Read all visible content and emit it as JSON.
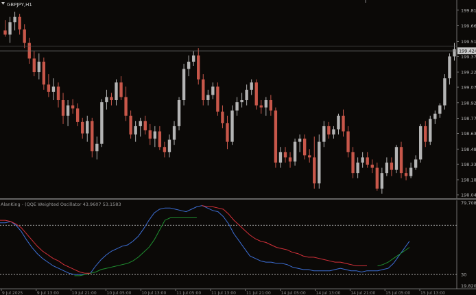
{
  "window": {
    "symbol": "GBPJPY,H1"
  },
  "colors": {
    "bull": "#b4b4b4",
    "bear": "#c8574a",
    "fast_line": "#3d6fd6",
    "slow_line": "#1f8f30",
    "up_line": "#d6303a",
    "bg": "#0b0907",
    "grid": "#8a8a8a"
  },
  "chart_data": [
    {
      "type": "candlestick",
      "symbol": "GBPJPY,H1",
      "ylim": [
        198.04,
        199.86
      ],
      "price_ticks": [
        "199.815",
        "199.665",
        "199.515",
        "199.370",
        "199.220",
        "199.075",
        "198.925",
        "198.775",
        "198.630",
        "198.480",
        "198.335",
        "198.185",
        "198.040"
      ],
      "current_price": "199.424",
      "ohlc": [
        [
          199.62,
          199.72,
          199.56,
          199.58
        ],
        [
          199.58,
          199.75,
          199.5,
          199.7
        ],
        [
          199.7,
          199.8,
          199.62,
          199.75
        ],
        [
          199.75,
          199.78,
          199.58,
          199.63
        ],
        [
          199.63,
          199.68,
          199.45,
          199.5
        ],
        [
          199.5,
          199.55,
          199.3,
          199.35
        ],
        [
          199.35,
          199.42,
          199.18,
          199.22
        ],
        [
          199.22,
          199.4,
          199.15,
          199.32
        ],
        [
          199.32,
          199.36,
          199.05,
          199.1
        ],
        [
          199.1,
          199.2,
          198.98,
          199.03
        ],
        [
          199.03,
          199.16,
          198.95,
          199.08
        ],
        [
          199.08,
          199.12,
          198.88,
          198.95
        ],
        [
          198.95,
          199.02,
          198.72,
          198.8
        ],
        [
          198.8,
          198.95,
          198.7,
          198.9
        ],
        [
          198.9,
          198.96,
          198.82,
          198.87
        ],
        [
          198.87,
          198.92,
          198.7,
          198.74
        ],
        [
          198.74,
          198.78,
          198.58,
          198.63
        ],
        [
          198.63,
          198.8,
          198.55,
          198.75
        ],
        [
          198.75,
          198.78,
          198.4,
          198.46
        ],
        [
          198.46,
          198.6,
          198.38,
          198.53
        ],
        [
          198.53,
          198.96,
          198.5,
          198.93
        ],
        [
          198.93,
          199.05,
          198.86,
          198.98
        ],
        [
          198.98,
          199.02,
          198.9,
          198.95
        ],
        [
          198.95,
          199.15,
          198.9,
          199.12
        ],
        [
          199.12,
          199.18,
          198.95,
          198.98
        ],
        [
          198.98,
          199.08,
          198.75,
          198.8
        ],
        [
          198.8,
          198.85,
          198.58,
          198.62
        ],
        [
          198.62,
          198.75,
          198.55,
          198.7
        ],
        [
          198.7,
          198.78,
          198.6,
          198.75
        ],
        [
          198.75,
          198.8,
          198.62,
          198.66
        ],
        [
          198.66,
          198.72,
          198.52,
          198.58
        ],
        [
          198.58,
          198.7,
          198.5,
          198.65
        ],
        [
          198.65,
          198.7,
          198.47,
          198.5
        ],
        [
          198.5,
          198.55,
          198.4,
          198.45
        ],
        [
          198.45,
          198.62,
          198.4,
          198.57
        ],
        [
          198.57,
          198.75,
          198.52,
          198.7
        ],
        [
          198.7,
          198.98,
          198.66,
          198.95
        ],
        [
          198.95,
          199.3,
          198.9,
          199.25
        ],
        [
          199.25,
          199.38,
          199.18,
          199.32
        ],
        [
          199.32,
          199.42,
          199.28,
          199.38
        ],
        [
          199.38,
          199.45,
          199.1,
          199.15
        ],
        [
          199.15,
          199.2,
          198.9,
          198.95
        ],
        [
          198.95,
          199.05,
          198.9,
          199.0
        ],
        [
          199.0,
          199.12,
          198.96,
          199.08
        ],
        [
          199.08,
          199.12,
          198.8,
          198.84
        ],
        [
          198.84,
          198.9,
          198.68,
          198.73
        ],
        [
          198.73,
          198.8,
          198.48,
          198.55
        ],
        [
          198.55,
          198.9,
          198.52,
          198.85
        ],
        [
          198.85,
          198.98,
          198.8,
          198.93
        ],
        [
          198.93,
          199.02,
          198.88,
          198.95
        ],
        [
          198.95,
          199.1,
          198.9,
          199.05
        ],
        [
          199.05,
          199.15,
          199.0,
          199.12
        ],
        [
          199.12,
          199.15,
          198.86,
          198.9
        ],
        [
          198.9,
          198.95,
          198.82,
          198.88
        ],
        [
          198.88,
          198.98,
          198.8,
          198.95
        ],
        [
          198.95,
          199.0,
          198.8,
          198.85
        ],
        [
          198.85,
          198.88,
          198.3,
          198.35
        ],
        [
          198.35,
          198.5,
          198.3,
          198.45
        ],
        [
          198.45,
          198.5,
          198.35,
          198.4
        ],
        [
          198.4,
          198.45,
          198.3,
          198.36
        ],
        [
          198.36,
          198.58,
          198.32,
          198.55
        ],
        [
          198.55,
          198.62,
          198.45,
          198.58
        ],
        [
          198.58,
          198.62,
          198.38,
          198.42
        ],
        [
          198.42,
          198.48,
          198.35,
          198.4
        ],
        [
          198.4,
          198.6,
          198.1,
          198.15
        ],
        [
          198.15,
          198.62,
          198.1,
          198.55
        ],
        [
          198.55,
          198.75,
          198.5,
          198.7
        ],
        [
          198.7,
          198.74,
          198.58,
          198.62
        ],
        [
          198.62,
          198.7,
          198.58,
          198.67
        ],
        [
          198.67,
          198.82,
          198.62,
          198.8
        ],
        [
          198.8,
          198.86,
          198.6,
          198.65
        ],
        [
          198.65,
          198.7,
          198.4,
          198.45
        ],
        [
          198.45,
          198.5,
          198.2,
          198.25
        ],
        [
          198.25,
          198.4,
          198.2,
          198.35
        ],
        [
          198.35,
          198.45,
          198.3,
          198.4
        ],
        [
          198.4,
          198.45,
          198.3,
          198.33
        ],
        [
          198.33,
          198.38,
          198.25,
          198.3
        ],
        [
          198.3,
          198.35,
          198.08,
          198.1
        ],
        [
          198.1,
          198.3,
          198.05,
          198.25
        ],
        [
          198.25,
          198.4,
          198.22,
          198.35
        ],
        [
          198.35,
          198.4,
          198.22,
          198.28
        ],
        [
          198.28,
          198.52,
          198.25,
          198.5
        ],
        [
          198.5,
          198.55,
          198.2,
          198.25
        ],
        [
          198.25,
          198.3,
          198.18,
          198.22
        ],
        [
          198.22,
          198.35,
          198.2,
          198.3
        ],
        [
          198.3,
          198.42,
          198.28,
          198.38
        ],
        [
          198.38,
          198.72,
          198.35,
          198.7
        ],
        [
          198.7,
          198.75,
          198.5,
          198.55
        ],
        [
          198.55,
          198.8,
          198.52,
          198.77
        ],
        [
          198.77,
          198.85,
          198.72,
          198.82
        ],
        [
          198.82,
          198.92,
          198.78,
          198.9
        ],
        [
          198.9,
          199.2,
          198.86,
          199.16
        ],
        [
          199.16,
          199.4,
          199.1,
          199.37
        ],
        [
          199.37,
          199.5,
          199.33,
          199.44
        ]
      ]
    },
    {
      "type": "line",
      "title": "AlanKing - (QQE Weighted Oscillator 43.9607 53.1583",
      "ylim": [
        20,
        88
      ],
      "levels": [
        "70",
        "30"
      ],
      "ticks": [
        "79.7084",
        "19.8203"
      ],
      "series": [
        {
          "color": "#3d6fd6",
          "values": [
            72,
            72,
            73,
            70,
            65,
            58,
            52,
            47,
            43,
            40,
            37,
            35,
            33,
            31,
            30,
            30,
            30,
            31,
            37,
            42,
            46,
            49,
            51,
            53,
            54,
            57,
            61,
            67,
            74,
            80,
            83,
            84,
            84,
            83,
            82,
            81,
            83,
            85,
            86,
            84,
            82,
            81,
            77,
            71,
            63,
            57,
            51,
            45,
            43,
            41,
            40,
            40,
            39,
            39,
            38,
            36,
            35,
            34,
            34,
            33,
            33,
            33,
            33,
            34,
            35,
            34,
            33,
            33,
            32,
            33,
            33,
            33,
            34,
            35,
            39,
            45,
            51,
            57
          ]
        },
        {
          "color": "#1f8f30",
          "values": [
            null,
            null,
            null,
            null,
            null,
            null,
            null,
            null,
            null,
            null,
            null,
            null,
            null,
            null,
            29,
            29,
            30,
            31,
            32,
            34,
            35,
            36,
            37,
            38,
            39,
            41,
            44,
            48,
            52,
            58,
            66,
            74,
            76,
            76,
            76,
            76,
            76,
            76,
            null,
            null,
            null,
            null,
            null,
            null,
            null,
            null,
            null,
            null,
            null,
            null,
            null,
            null,
            null,
            null,
            null,
            null,
            null,
            null,
            null,
            null,
            null,
            null,
            null,
            null,
            null,
            null,
            null,
            null,
            null,
            null,
            null,
            37,
            38,
            40,
            43,
            46,
            49,
            52
          ]
        },
        {
          "color": "#d6303a",
          "values": [
            74,
            74,
            73,
            71,
            68,
            63,
            58,
            53,
            49,
            46,
            43,
            41,
            38,
            36,
            34,
            32,
            31,
            31,
            null,
            null,
            null,
            null,
            null,
            null,
            null,
            null,
            null,
            null,
            null,
            null,
            null,
            null,
            null,
            null,
            null,
            null,
            null,
            null,
            86,
            85,
            85,
            84,
            83,
            79,
            74,
            70,
            66,
            62,
            59,
            57,
            56,
            54,
            52,
            51,
            50,
            48,
            47,
            45,
            44,
            44,
            43,
            42,
            41,
            40,
            40,
            39,
            38,
            37,
            37,
            37,
            null,
            null,
            null,
            null,
            null,
            null,
            null,
            null
          ]
        }
      ]
    }
  ],
  "time_labels": [
    "9 Jul 2025",
    "9 Jul 13:00",
    "10 Jul 21:00",
    "10 Jul 05:00",
    "10 Jul 13:00",
    "11 Jul 05:00",
    "11 Jul 13:00",
    "11 Jul 21:00",
    "14 Jul 05:00",
    "14 Jul 13:00",
    "14 Jul 21:00",
    "15 Jul 05:00",
    "15 Jul 13:00"
  ]
}
